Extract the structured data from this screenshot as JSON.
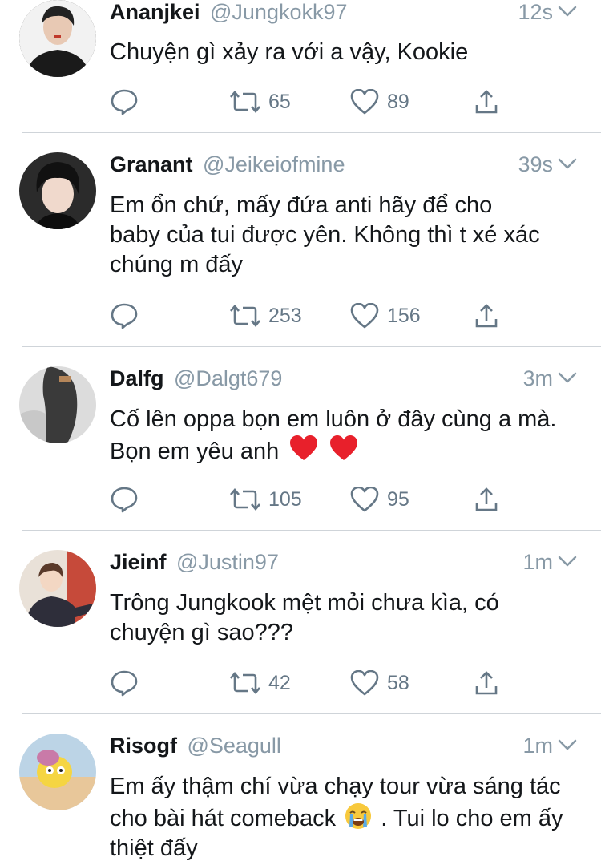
{
  "tweets": [
    {
      "name": "Ananjkei",
      "handle": "@Jungkokk97",
      "time": "12s",
      "text": "Chuyện gì xảy ra với a vậy, Kookie",
      "retweets": "65",
      "likes": "89"
    },
    {
      "name": "Granant",
      "handle": "@Jeikeiofmine",
      "time": "39s",
      "text": "Em ổn chứ, mấy đứa anti hãy để cho baby của tui được yên. Không thì t xé xác chúng m đấy",
      "retweets": "253",
      "likes": "156"
    },
    {
      "name": "Dalfg",
      "handle": "@Dalgt679",
      "time": "3m",
      "text": "Cố lên oppa bọn em luôn ở đây cùng a mà. Bọn em yêu anh",
      "emoji": "red-heart-x2",
      "retweets": "105",
      "likes": "95"
    },
    {
      "name": "Jieinf",
      "handle": "@Justin97",
      "time": "1m",
      "text": "Trông Jungkook mệt mỏi chưa kìa, có chuyện gì sao???",
      "retweets": "42",
      "likes": "58"
    },
    {
      "name": "Risogf",
      "handle": "@Seagull",
      "time": "1m",
      "text_before": "Em ấy thậm chí vừa chạy tour vừa sáng tác cho bài hát comeback",
      "text_after": ". Tui lo cho em ấy thiệt đấy",
      "emoji": "loudly-crying-face"
    }
  ],
  "colors": {
    "text": "#14171a",
    "secondary": "#8899a6",
    "icon": "#657786",
    "divider": "#cfd4d9"
  }
}
